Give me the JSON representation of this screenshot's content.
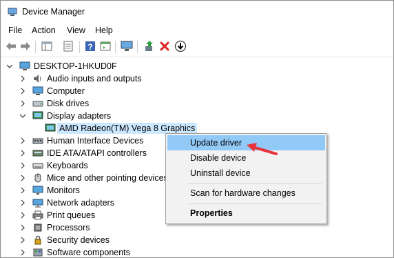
{
  "window": {
    "title": "Device Manager"
  },
  "menu": {
    "file": "File",
    "action": "Action",
    "view": "View",
    "help": "Help"
  },
  "toolbar": {
    "icons": [
      "back-arrow-icon",
      "forward-arrow-icon",
      "show-hide-tree-icon",
      "properties-icon",
      "help-icon",
      "properties-sheet-icon",
      "scan-hardware-monitor-icon",
      "update-driver-icon",
      "uninstall-x-icon",
      "disable-down-arrow-icon"
    ],
    "colors": {
      "x_red": "#e02020",
      "update_green": "#2e9e3e"
    }
  },
  "tree": {
    "root": "DESKTOP-1HKUD0F",
    "categories": [
      "Audio inputs and outputs",
      "Computer",
      "Disk drives",
      "Display adapters",
      "Human Interface Devices",
      "IDE ATA/ATAPI controllers",
      "Keyboards",
      "Mice and other pointing devices",
      "Monitors",
      "Network adapters",
      "Print queues",
      "Processors",
      "Security devices",
      "Software components"
    ],
    "display_child": "AMD Radeon(TM) Vega 8 Graphics"
  },
  "context_menu": {
    "update_driver": "Update driver",
    "disable_device": "Disable device",
    "uninstall_device": "Uninstall device",
    "scan_hardware": "Scan for hardware changes",
    "properties": "Properties",
    "highlight_color": "#91c9f7"
  },
  "annotation": {
    "arrow_color": "#e8333a"
  }
}
